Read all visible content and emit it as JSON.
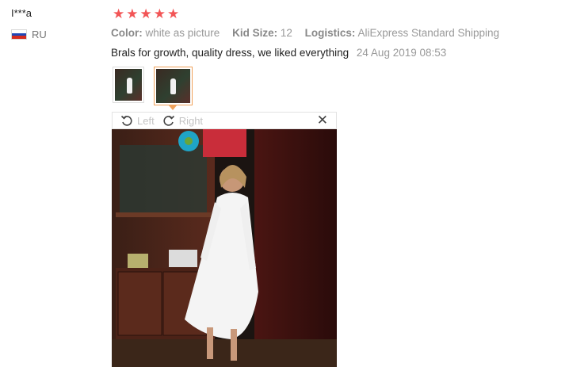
{
  "user": {
    "name": "I***a",
    "country": "RU"
  },
  "rating": {
    "stars": 5,
    "max": 5
  },
  "attributes": [
    {
      "key": "Color:",
      "value": "white as picture"
    },
    {
      "key": "Kid Size:",
      "value": "12"
    },
    {
      "key": "Logistics:",
      "value": "AliExpress Standard Shipping"
    }
  ],
  "review": {
    "text": "Brals for growth, quality dress, we liked everything",
    "date": "24 Aug 2019 08:53"
  },
  "toolbar": {
    "left_label": "Left",
    "right_label": "Right",
    "close_symbol": "✕"
  },
  "colors": {
    "star": "#f25556",
    "active_border": "#f0a25b"
  },
  "icons": {
    "rotate_left": "rotate-left-icon",
    "rotate_right": "rotate-right-icon",
    "close": "close-icon"
  }
}
